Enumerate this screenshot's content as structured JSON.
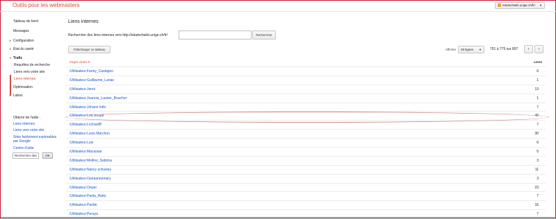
{
  "app": {
    "title": "Outils pour les webmasters",
    "site": "edutechwiki.unige.ch/fr/"
  },
  "sidebar": {
    "items": [
      {
        "label": "Tableau de bord"
      },
      {
        "label": "Messages"
      },
      {
        "label": "Configuration"
      },
      {
        "label": "État du santé"
      },
      {
        "label": "Trafic"
      },
      {
        "label": "Requêtes de recherche"
      },
      {
        "label": "Liens vers votre site"
      },
      {
        "label": "Liens internes"
      },
      {
        "label": "Optimisation"
      },
      {
        "label": "Labos"
      }
    ],
    "help": {
      "title": "Obtenir de l'aide :",
      "links": [
        "Liens internes",
        "Liens vers votre site",
        "Sites facilement explorables par Google",
        "Centre d'aide"
      ],
      "search_label": "Rechercher dan",
      "ok": "OK"
    }
  },
  "main": {
    "title": "Liens internes",
    "search_label": "Rechercher des liens internes vers http://edutechwiki.unige.ch/fr/",
    "search_value": "",
    "search_button": "Rechercher",
    "download_button": "Télécharger ce tableau",
    "show_label": "Afficher",
    "rows_option": "25 lignes",
    "range": "751 à 775 sur 807",
    "prev": "‹",
    "next": "›",
    "col_pages": "Pages cibles ▾",
    "col_links": "Liens",
    "rows": [
      {
        "page": "/Utilisateur:Fanny_Castagno",
        "links": "6"
      },
      {
        "page": "/Utilisateur:Guillaume_Lariae",
        "links": "1"
      },
      {
        "page": "/Utilisateur:Jenni",
        "links": "13"
      },
      {
        "page": "/Utilisateur:Joannie_Laurier_Boucher",
        "links": "1"
      },
      {
        "page": "/Utilisateur:Johann lothi",
        "links": "7"
      },
      {
        "page": "/Utilisateur:Loic.bougé",
        "links": "40"
      },
      {
        "page": "/Utilisateur:Lochardff",
        "links": "7"
      },
      {
        "page": "/Utilisateur:Lucie.Marchon",
        "links": "30"
      },
      {
        "page": "/Utilisateur:Luis",
        "links": "6"
      },
      {
        "page": "/Utilisateur:Macassar",
        "links": "5"
      },
      {
        "page": "/Utilisateur:Mollino_Sabrina",
        "links": "3"
      },
      {
        "page": "/Utilisateur:Nancy schuwey",
        "links": "11"
      },
      {
        "page": "/Utilisateur:Oanaannemary",
        "links": "3"
      },
      {
        "page": "/Utilisateur:Ortaer",
        "links": "23"
      },
      {
        "page": "/Utilisateur:Paola_Rattu",
        "links": "7"
      },
      {
        "page": "/Utilisateur:Pardiri",
        "links": "16"
      },
      {
        "page": "/Utilisateur:Peraya",
        "links": "7"
      }
    ]
  }
}
